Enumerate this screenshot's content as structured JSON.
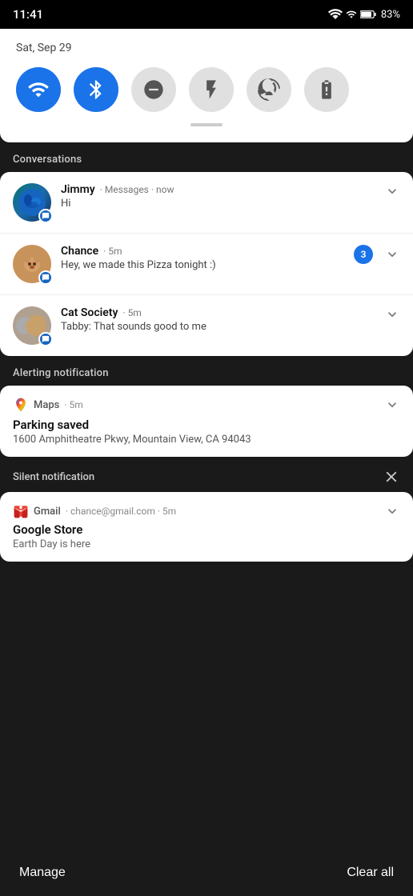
{
  "statusBar": {
    "time": "11:41",
    "battery": "83%",
    "wifiIcon": "wifi-icon",
    "signalIcon": "signal-icon",
    "batteryIcon": "battery-icon"
  },
  "quickSettings": {
    "date": "Sat, Sep 29",
    "toggles": [
      {
        "id": "wifi",
        "label": "WiFi",
        "active": true
      },
      {
        "id": "bluetooth",
        "label": "Bluetooth",
        "active": true
      },
      {
        "id": "dnd",
        "label": "Do Not Disturb",
        "active": false
      },
      {
        "id": "flashlight",
        "label": "Flashlight",
        "active": false
      },
      {
        "id": "rotate",
        "label": "Auto Rotate",
        "active": false
      },
      {
        "id": "battery-saver",
        "label": "Battery Saver",
        "active": false
      }
    ]
  },
  "conversations": {
    "sectionLabel": "Conversations",
    "items": [
      {
        "sender": "Jimmy",
        "app": "Messages",
        "time": "now",
        "message": "Hi",
        "unreadCount": null
      },
      {
        "sender": "Chance",
        "app": "",
        "time": "5m",
        "message": "Hey, we made this Pizza tonight :)",
        "unreadCount": 3
      },
      {
        "sender": "Cat Society",
        "app": "",
        "time": "5m",
        "message": "Tabby: That sounds good to me",
        "unreadCount": null
      }
    ]
  },
  "alertingNotification": {
    "sectionLabel": "Alerting notification",
    "app": "Maps",
    "time": "5m",
    "title": "Parking saved",
    "body": "1600 Amphitheatre Pkwy, Mountain View, CA 94043"
  },
  "silentNotification": {
    "sectionLabel": "Silent notification",
    "app": "Gmail",
    "email": "chance@gmail.com",
    "time": "5m",
    "title": "Google Store",
    "body": "Earth Day is here"
  },
  "bottomBar": {
    "manageLabel": "Manage",
    "clearAllLabel": "Clear all"
  }
}
